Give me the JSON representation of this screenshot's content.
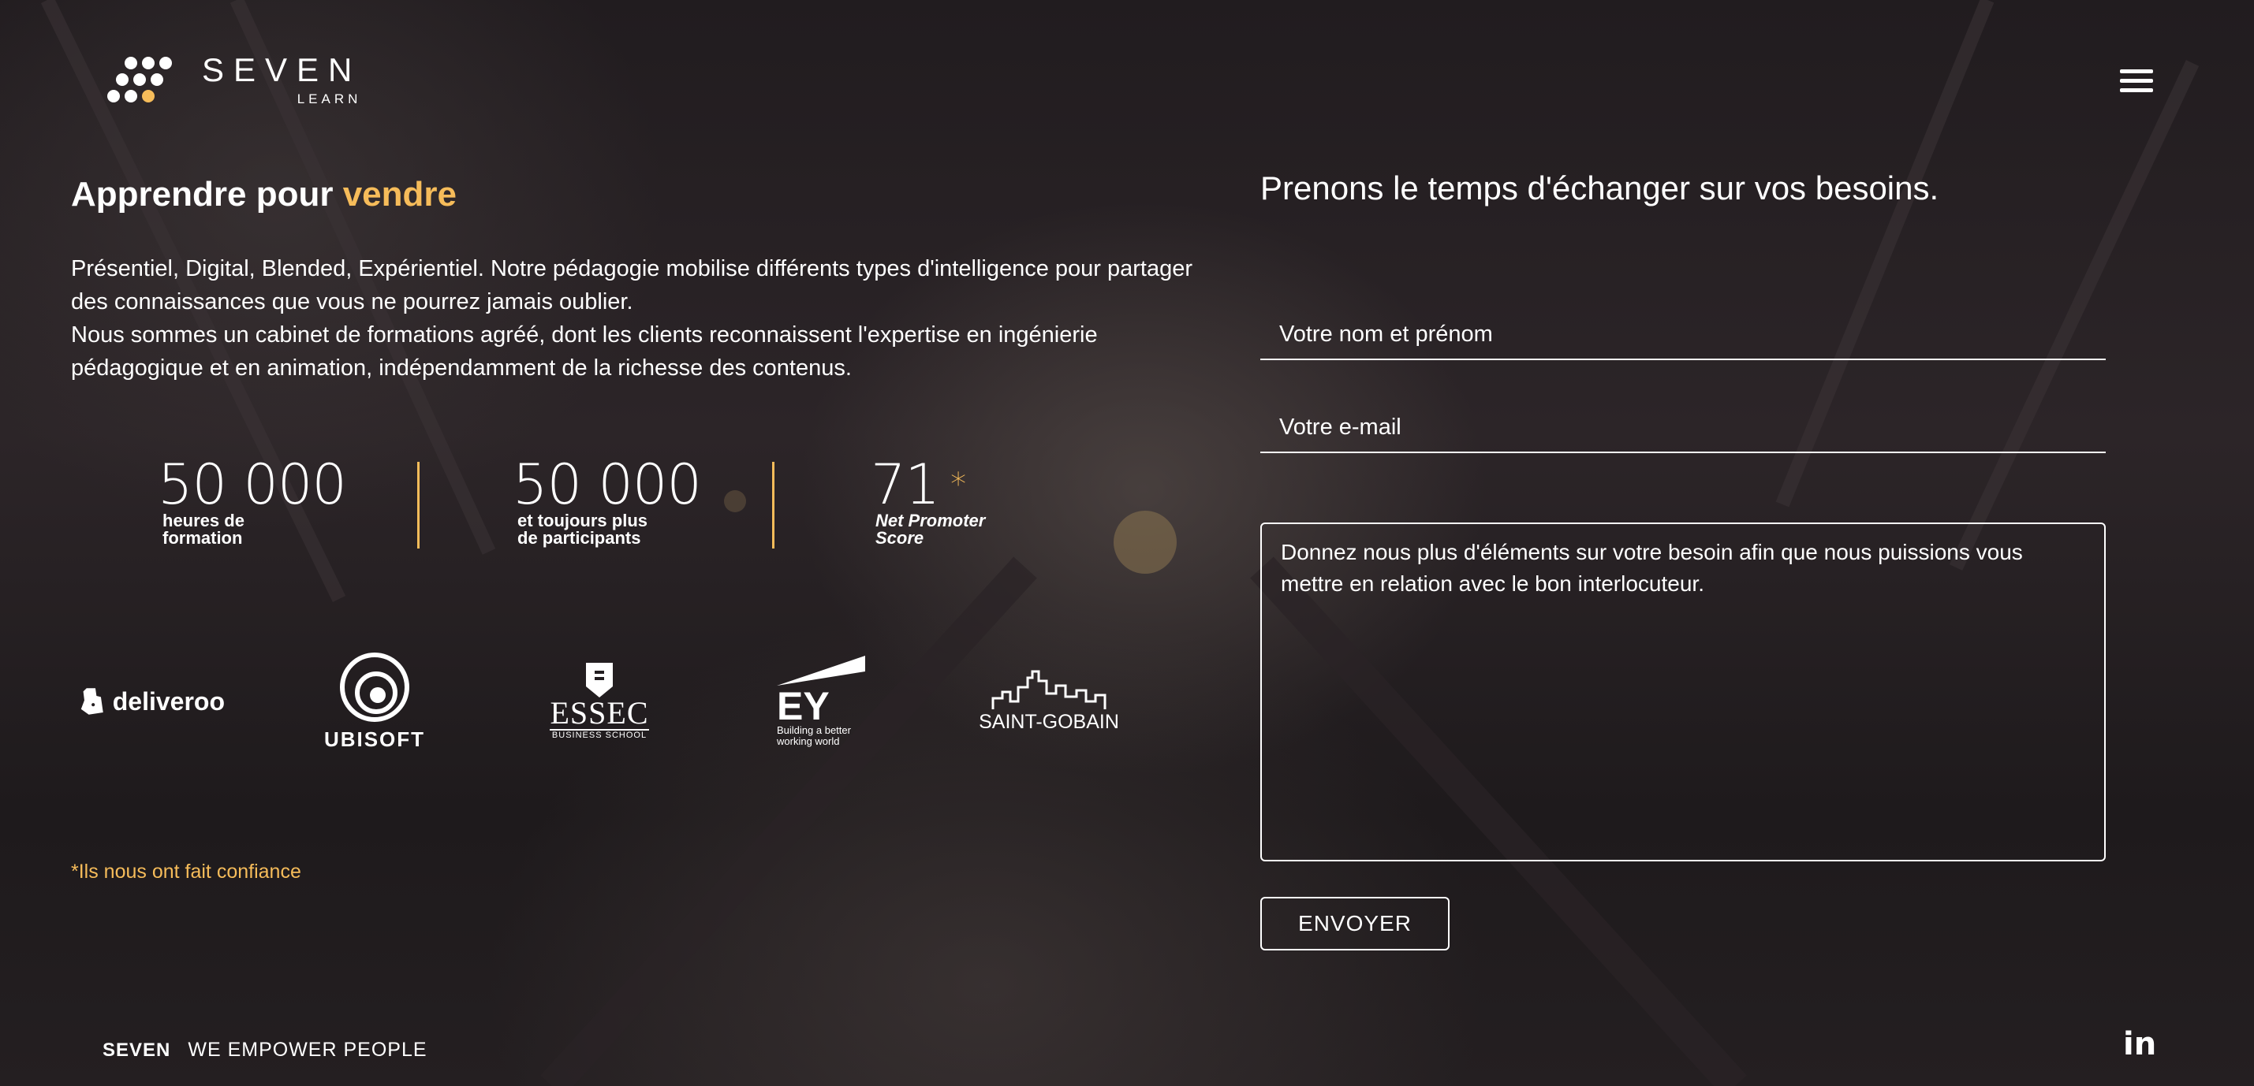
{
  "header": {
    "logo_word": "SEVEN",
    "logo_sub": "LEARN",
    "menu_icon": "hamburger-menu-icon"
  },
  "hero": {
    "title_part1": "Apprendre pour ",
    "title_accent": "vendre",
    "intro_line1": "Présentiel, Digital, Blended, Expérientiel. Notre pédagogie mobilise différents types d'intelligence pour partager des connaissances que vous ne pourrez jamais oublier.",
    "intro_line2": "Nous sommes un cabinet de formations agréé, dont les clients reconnaissent l'expertise en ingénierie pédagogique et en animation, indépendamment de la richesse des contenus."
  },
  "stats": [
    {
      "value": "50 000",
      "label_line1": "heures de",
      "label_line2": "formation"
    },
    {
      "value": "50 000",
      "label_line1": "et toujours plus",
      "label_line2": "de participants"
    },
    {
      "value": "71",
      "star": "*",
      "label_line1": "Net Promoter",
      "label_line2": "Score"
    }
  ],
  "clients": {
    "deliveroo": "deliveroo",
    "ubisoft": "UBISOFT",
    "essec": "ESSEC",
    "essec_sub": "BUSINESS SCHOOL",
    "ey": "EY",
    "ey_sub1": "Building a better",
    "ey_sub2": "working world",
    "saint_gobain": "SAINT-GOBAIN"
  },
  "trust_note": "*Ils nous ont fait confiance",
  "form": {
    "title": "Prenons le temps d'échanger sur vos besoins.",
    "name_placeholder": "Votre nom et prénom",
    "email_placeholder": "Votre e-mail",
    "message_placeholder": "Donnez nous plus d'éléments sur votre besoin afin que nous puissions vous mettre en relation avec le bon interlocuteur.",
    "submit_label": "ENVOYER"
  },
  "footer": {
    "brand": "SEVEN",
    "tagline": "WE EMPOWER PEOPLE",
    "social_label": "in"
  },
  "colors": {
    "accent": "#f6bc5a",
    "text": "#ffffff",
    "background": "#231e21"
  }
}
